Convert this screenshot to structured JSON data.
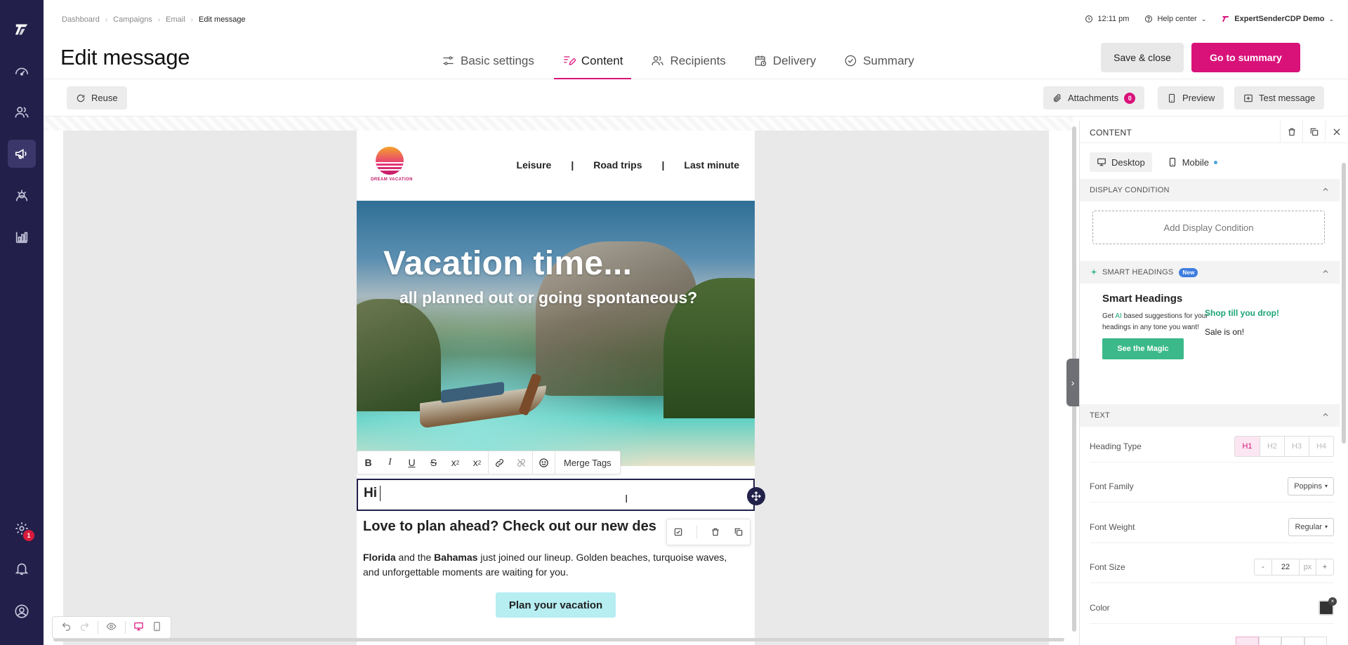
{
  "breadcrumb": [
    "Dashboard",
    "Campaigns",
    "Email",
    "Edit message"
  ],
  "page_title": "Edit message",
  "top_right": {
    "time": "12:11 pm",
    "help": "Help center",
    "account": "ExpertSenderCDP Demo"
  },
  "tabs": [
    {
      "label": "Basic settings",
      "icon": "sliders-icon"
    },
    {
      "label": "Content",
      "icon": "edit-icon"
    },
    {
      "label": "Recipients",
      "icon": "users-icon"
    },
    {
      "label": "Delivery",
      "icon": "calendar-clock-icon"
    },
    {
      "label": "Summary",
      "icon": "check-circle-icon"
    }
  ],
  "actions": {
    "save_close": "Save & close",
    "go_summary": "Go to summary"
  },
  "toolbar": {
    "reuse": "Reuse",
    "attachments": "Attachments",
    "attachments_count": "0",
    "preview": "Preview",
    "test_message": "Test message"
  },
  "sidebar": {
    "settings_badge": "1"
  },
  "email": {
    "logo_text": "DREAM VACATION",
    "nav": [
      "Leisure",
      "|",
      "Road trips",
      "|",
      "Last minute"
    ],
    "hero_title": "Vacation time...",
    "hero_subtitle": "all planned out or going spontaneous?",
    "format_merge": "Merge Tags",
    "hi_text": "Hi",
    "heading": "Love to plan ahead? Check out our new des",
    "para_b1": "Florida",
    "para_t1": " and the ",
    "para_b2": "Bahamas",
    "para_t2": " just joined our lineup. Golden beaches, turquoise waves, and unforgettable moments are waiting for you.",
    "cta": "Plan your vacation",
    "cta_color": "#b6eef2"
  },
  "panel": {
    "title": "CONTENT",
    "tab_desktop": "Desktop",
    "tab_mobile": "Mobile",
    "display_condition": "DISPLAY CONDITION",
    "add_condition": "Add Display Condition",
    "smart_headings": "SMART HEADINGS",
    "new_badge": "New",
    "smart_title": "Smart Headings",
    "smart_desc_1": "Get ",
    "smart_desc_ai": "AI",
    "smart_desc_2": " based suggestions for your headings in any tone you want!",
    "smart_button": "See the Magic",
    "smart_sample_1": "Shop till you drop!",
    "smart_sample_2": "Sale is on!",
    "text_section": "TEXT",
    "heading_type_label": "Heading Type",
    "heading_types": [
      "H1",
      "H2",
      "H3",
      "H4"
    ],
    "heading_type_selected": "H1",
    "font_family_label": "Font Family",
    "font_family_value": "Poppins",
    "font_weight_label": "Font Weight",
    "font_weight_value": "Regular",
    "font_size_label": "Font Size",
    "font_size_value": "22",
    "font_size_unit": "px",
    "minus": "-",
    "plus": "+",
    "color_label": "Color",
    "color_value": "#333333"
  },
  "colors": {
    "accent": "#d9127a",
    "sidebar": "#221f4a",
    "smart_green": "#3bb98a"
  }
}
